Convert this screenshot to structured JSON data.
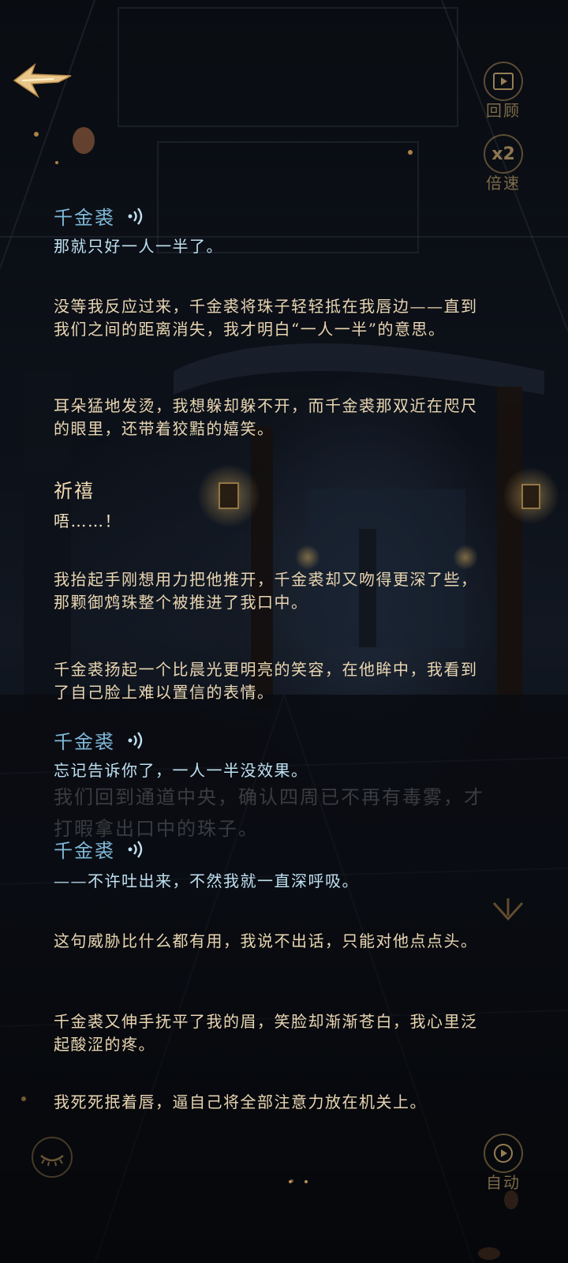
{
  "controls": {
    "review_label": "回顾",
    "speed_value": "x2",
    "speed_label": "倍速",
    "auto_label": "自动"
  },
  "dialogue": [
    {
      "speaker": "千金裘",
      "text": "那就只好一人一半了。"
    },
    {
      "text": "没等我反应过来，千金裘将珠子轻轻抵在我唇边——直到我们之间的距离消失，我才明白“一人一半”的意思。"
    },
    {
      "text": "耳朵猛地发烫，我想躲却躲不开，而千金裘那双近在咫尺的眼里，还带着狡黠的嬉笑。"
    },
    {
      "speaker": "祈禧",
      "text": "唔……！"
    },
    {
      "text": "我抬起手刚想用力把他推开，千金裘却又吻得更深了些，那颗御鸩珠整个被推进了我口中。"
    },
    {
      "text": "千金裘扬起一个比晨光更明亮的笑容，在他眸中，我看到了自己脸上难以置信的表情。"
    },
    {
      "speaker": "千金裘",
      "text": "忘记告诉你了，一人一半没效果。"
    },
    {
      "speaker": "千金裘",
      "text": "——不许吐出来，不然我就一直深呼吸。"
    },
    {
      "text": "这句威胁比什么都有用，我说不出话，只能对他点点头。"
    },
    {
      "text": "千金裘又伸手抚平了我的眉，笑脸却渐渐苍白，我心里泛起酸涩的疼。"
    },
    {
      "text": "我死死抿着唇，逼自己将全部注意力放在机关上。"
    }
  ],
  "ghost_text": "我们回到通道中央，确认四周已不再有毒雾，才打暇拿出口中的珠子。",
  "colors": {
    "speaker_blue": "#7fb8d8",
    "speaker_gold": "#f1dab0",
    "accent_gold": "#c9a465"
  }
}
